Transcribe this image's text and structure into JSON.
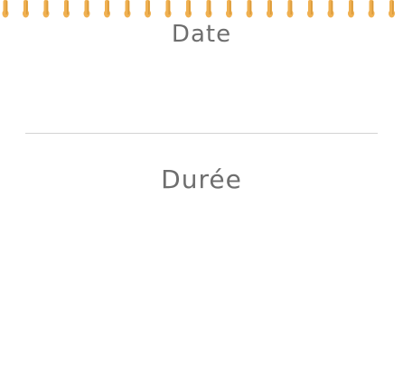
{
  "card": {
    "date_label": "Date",
    "duration_label": "Durée"
  },
  "colors": {
    "ring_color": "#f0b050",
    "ring_dark": "#c98a2e",
    "text": "#6e6e6e",
    "divider": "#d3d3d3"
  },
  "icons": {
    "binding": "spiral-binding-rings"
  }
}
